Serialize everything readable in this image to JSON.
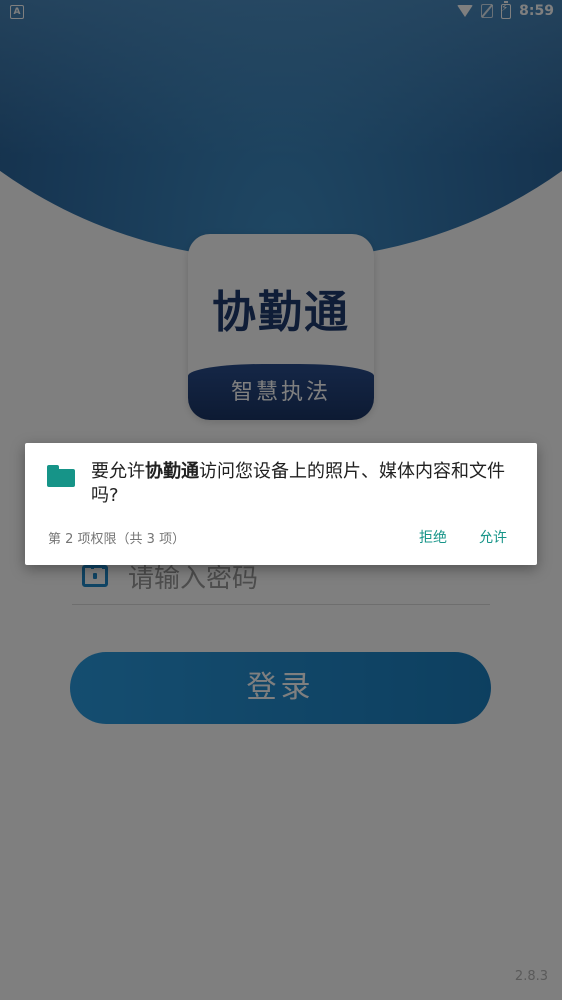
{
  "status_bar": {
    "left_indicator": "A",
    "time": "8:59",
    "icons": [
      "wifi-icon",
      "no-sim-icon",
      "battery-charging-icon"
    ]
  },
  "logo": {
    "title": "协勤通",
    "subtitle": "智慧执法"
  },
  "login": {
    "password_placeholder": "请输入密码",
    "login_button": "登录"
  },
  "version": "2.8.3",
  "permission_dialog": {
    "icon": "folder-icon",
    "message_prefix": "要允许",
    "app_name": "协勤通",
    "message_suffix": "访问您设备上的照片、媒体内容和文件吗?",
    "counter": "第 2 项权限（共 3 项）",
    "deny_label": "拒绝",
    "allow_label": "允许",
    "accent_color": "#169488"
  },
  "colors": {
    "brand_blue": "#1e88c8",
    "hero_dark": "#1f4673"
  }
}
